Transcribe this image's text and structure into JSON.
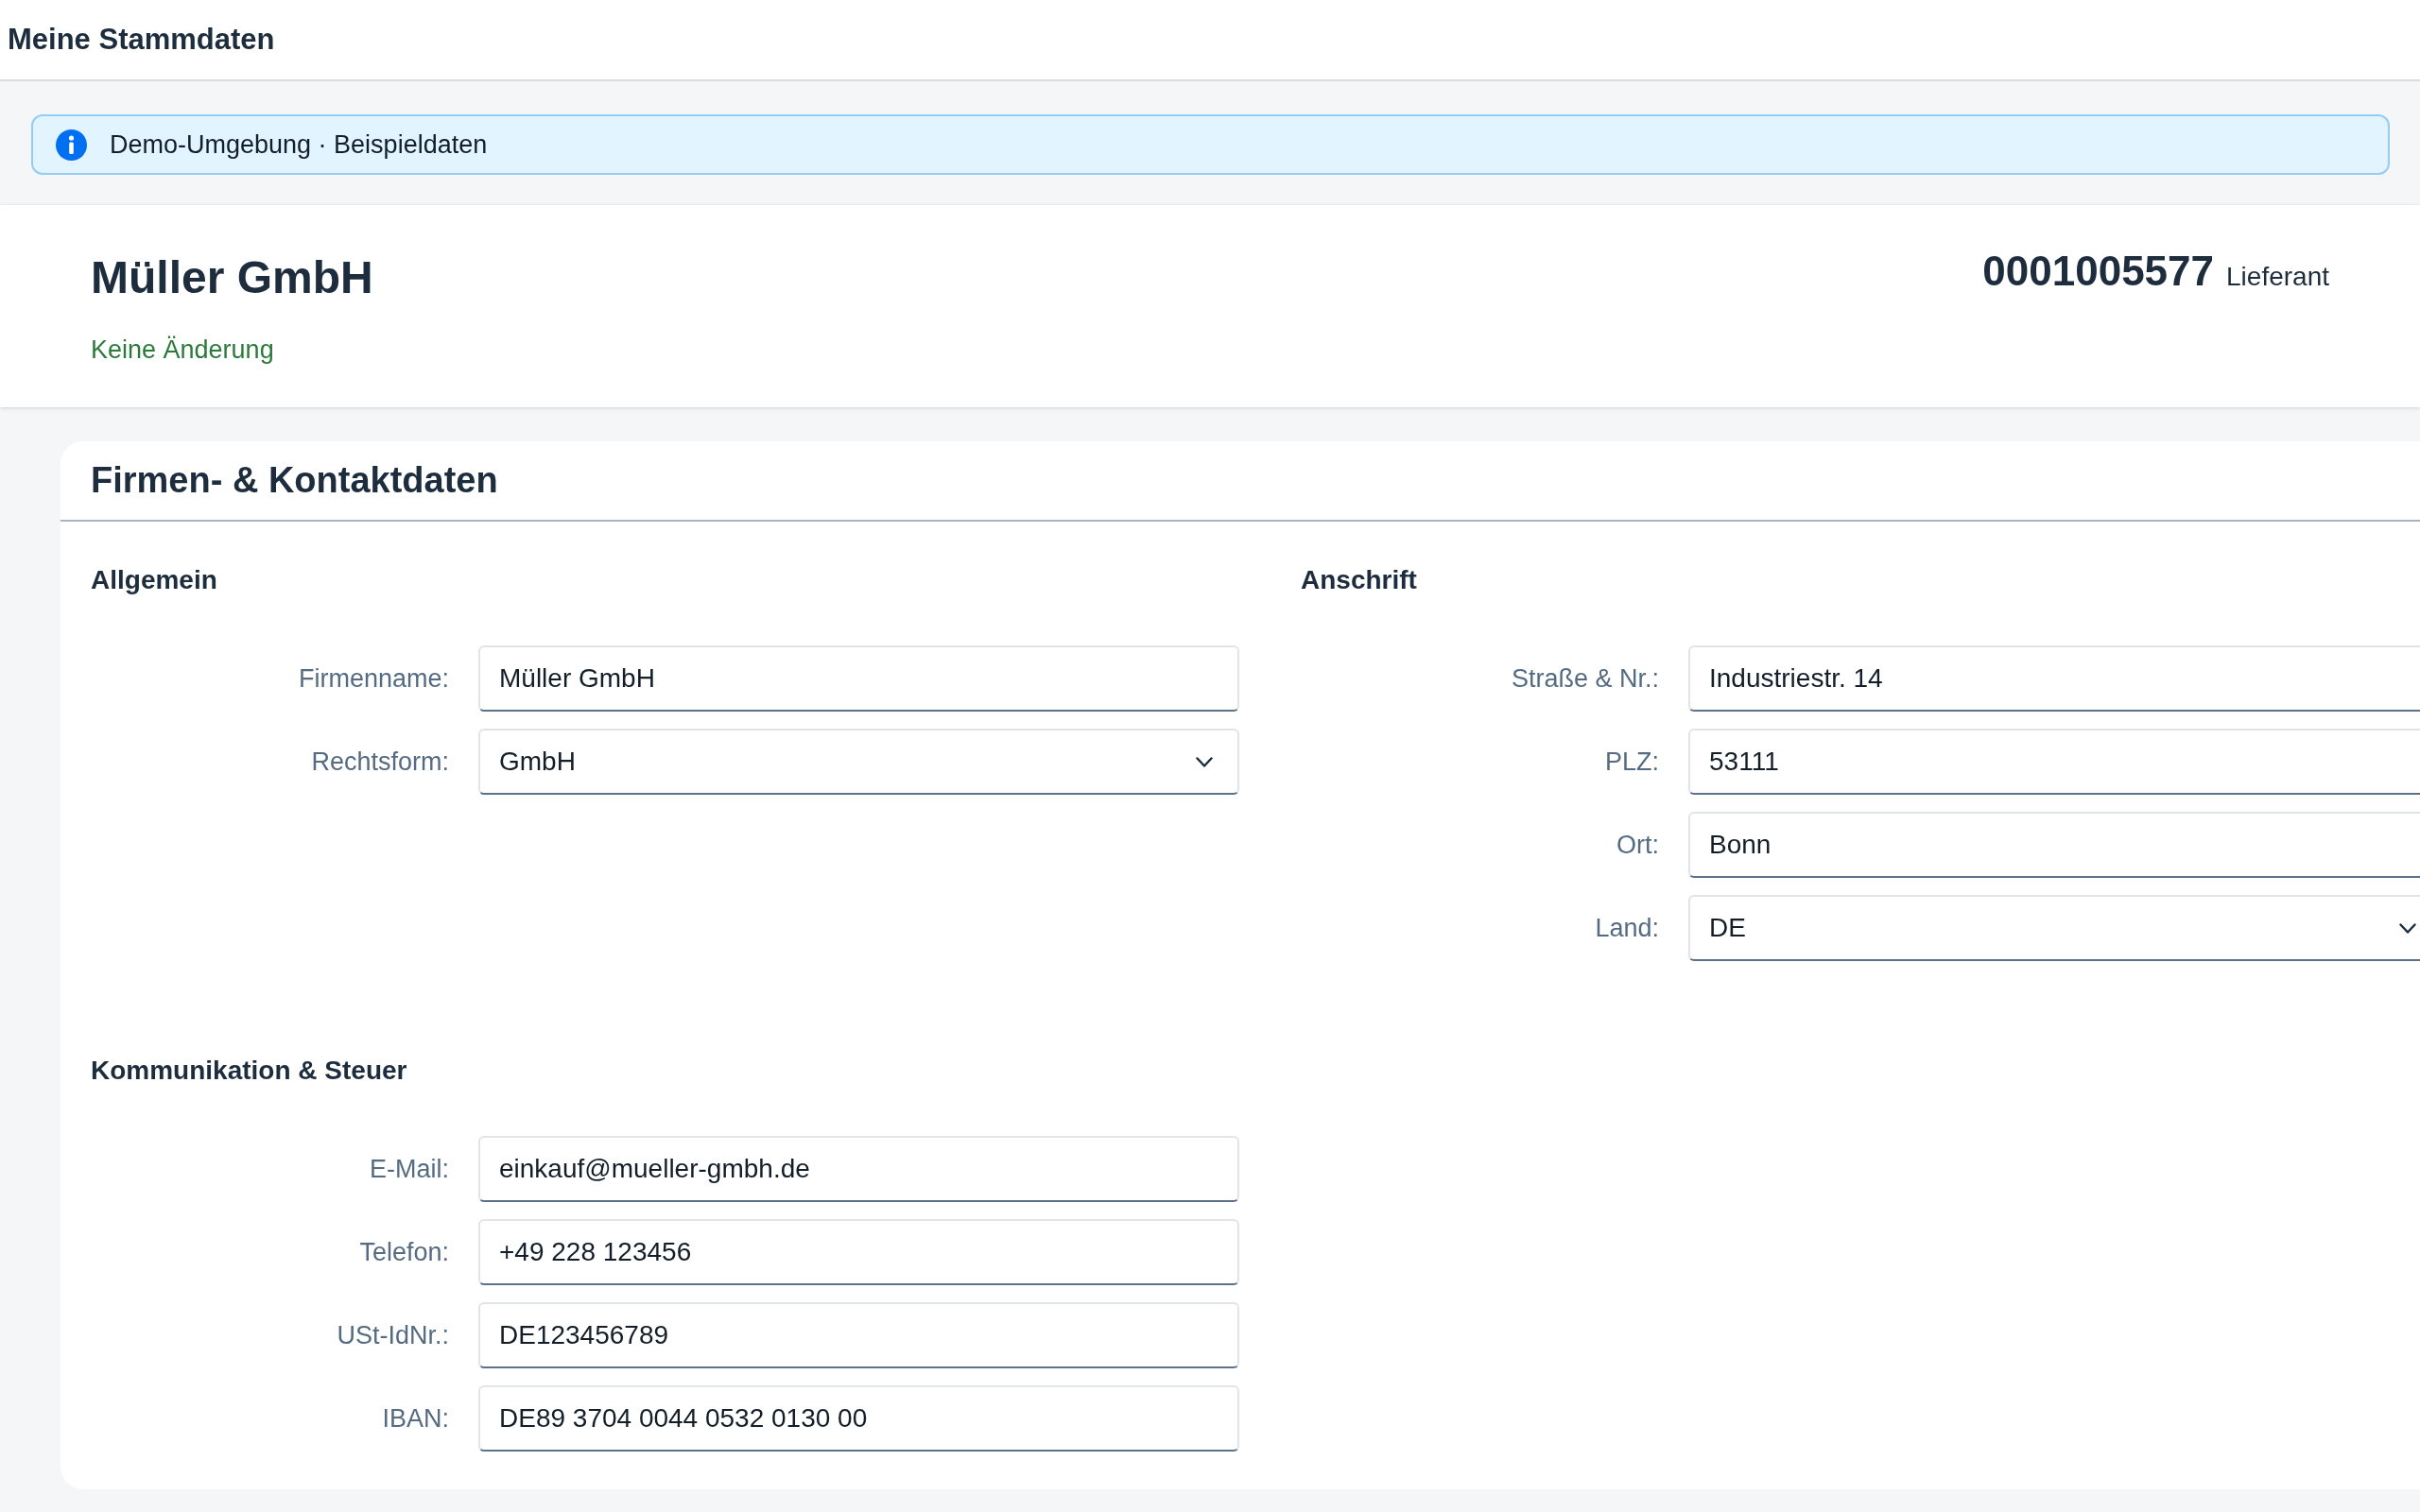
{
  "shell_bar": {
    "title": "Meine Stammdaten"
  },
  "message_strip": {
    "kind": "information",
    "text": "Demo-Umgebung · Beispieldaten"
  },
  "object_header": {
    "title": "Müller GmbH",
    "status": "Keine Änderung",
    "number": "0001005577",
    "number_unit": "Lieferant"
  },
  "section": {
    "title": "Firmen- & Kontaktdaten",
    "groups": [
      {
        "title": "Allgemein",
        "fields": [
          {
            "label": "Firmenname:",
            "value": "Müller GmbH",
            "kind": "input"
          },
          {
            "label": "Rechtsform:",
            "value": "GmbH",
            "kind": "select"
          }
        ]
      },
      {
        "title": "Anschrift",
        "fields": [
          {
            "label": "Straße & Nr.:",
            "value": "Industriestr. 14",
            "kind": "input"
          },
          {
            "label": "PLZ:",
            "value": "53111",
            "kind": "input"
          },
          {
            "label": "Ort:",
            "value": "Bonn",
            "kind": "input"
          },
          {
            "label": "Land:",
            "value": "DE",
            "kind": "select"
          }
        ]
      },
      {
        "title": "Kommunikation & Steuer",
        "fields": [
          {
            "label": "E-Mail:",
            "value": "einkauf@mueller-gmbh.de",
            "kind": "input"
          },
          {
            "label": "Telefon:",
            "value": "+49 228 123456",
            "kind": "input"
          },
          {
            "label": "USt-IdNr.:",
            "value": "DE123456789",
            "kind": "input"
          },
          {
            "label": "IBAN:",
            "value": "DE89 3704 0044 0532 0130 00",
            "kind": "input"
          }
        ]
      }
    ]
  }
}
